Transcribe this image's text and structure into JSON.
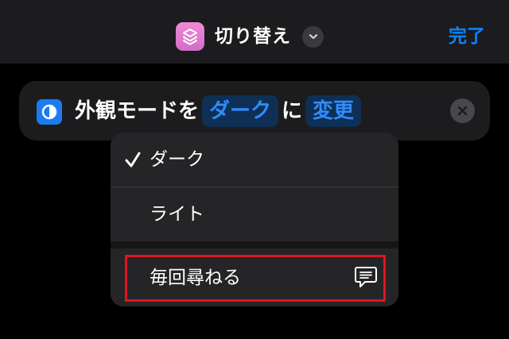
{
  "navbar": {
    "title": "切り替え",
    "done_label": "完了",
    "icons": {
      "app": "shortcuts-layers-icon",
      "title_menu": "chevron-down-icon"
    }
  },
  "action": {
    "text_before": "外観モードを",
    "appearance_value": "ダーク",
    "text_middle": "に",
    "operation_value": "変更",
    "icons": {
      "action": "appearance-icon",
      "clear": "close-icon"
    }
  },
  "menu": {
    "items": [
      {
        "label": "ダーク",
        "selected": true
      },
      {
        "label": "ライト",
        "selected": false
      },
      {
        "label": "毎回尋ねる",
        "selected": false,
        "icon": "speech-bubble-icon"
      }
    ]
  },
  "colors": {
    "accent": "#0a84ff",
    "token_text": "#2f8cff",
    "token_background": "#0f2f55",
    "app_icon": "#e47fd2",
    "action_icon": "#1a7cf0",
    "highlight": "#e0141e",
    "background": "#000000",
    "surface": "#1c1c1e"
  }
}
